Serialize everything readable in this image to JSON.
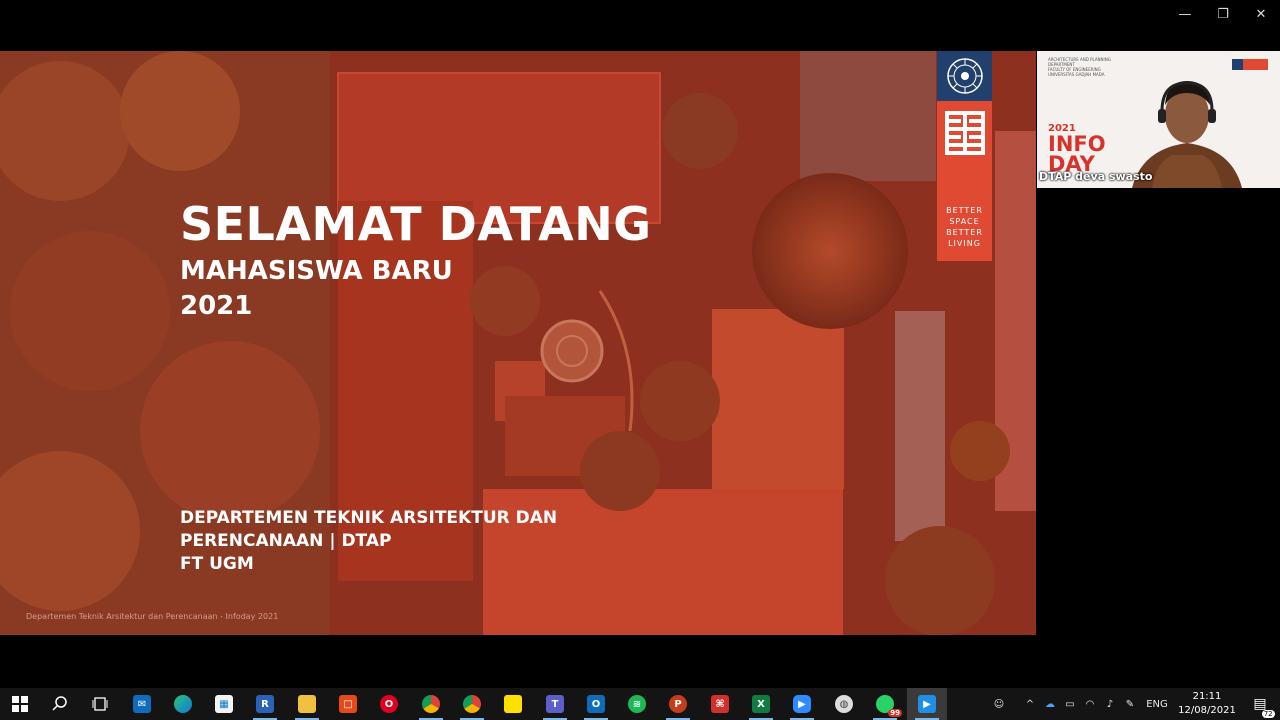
{
  "window": {
    "minimize_glyph": "—",
    "restore_glyph": "❐",
    "close_glyph": "✕"
  },
  "slide": {
    "title": "SELAMAT DATANG",
    "subtitle_line1": "MAHASISWA BARU",
    "subtitle_line2": "2021",
    "department_line1": "DEPARTEMEN TEKNIK ARSITEKTUR DAN",
    "department_line2": "PERENCANAAN | DTAP",
    "department_line3": "FT UGM",
    "footer": "Departemen Teknik Arsitektur dan Perencanaan - Infoday 2021",
    "logo_tagline": [
      "BETTER",
      "SPACE",
      "BETTER",
      "LIVING"
    ]
  },
  "video": {
    "participant_name": "DTAP deva swasto",
    "header_lines": [
      "ARCHITECTURE AND PLANNING DEPARTMENT",
      "FACULTY OF ENGINEERING",
      "UNIVERSITAS GADJAH MADA"
    ],
    "event_year": "2021",
    "event_word1": "INFO",
    "event_word2": "DAY"
  },
  "taskbar": {
    "apps": [
      {
        "name": "start",
        "icon": "windows-logo-icon"
      },
      {
        "name": "search",
        "icon": "search-icon"
      },
      {
        "name": "task-view",
        "icon": "task-view-icon"
      },
      {
        "name": "mail",
        "icon": "mail-icon"
      },
      {
        "name": "edge",
        "icon": "edge-icon"
      },
      {
        "name": "store",
        "icon": "store-icon"
      },
      {
        "name": "revit",
        "icon": "revit-icon",
        "glyph": "R"
      },
      {
        "name": "file-explorer",
        "icon": "folder-icon"
      },
      {
        "name": "office",
        "icon": "office-icon"
      },
      {
        "name": "opera",
        "icon": "opera-icon",
        "glyph": "O"
      },
      {
        "name": "chrome",
        "icon": "chrome-icon"
      },
      {
        "name": "chrome-profile",
        "icon": "chrome-icon"
      },
      {
        "name": "sticky-notes",
        "icon": "sticky-notes-icon"
      },
      {
        "name": "teams",
        "icon": "teams-icon",
        "glyph": "T"
      },
      {
        "name": "outlook",
        "icon": "outlook-icon",
        "glyph": "O"
      },
      {
        "name": "spotify",
        "icon": "spotify-icon"
      },
      {
        "name": "powerpoint",
        "icon": "powerpoint-icon",
        "glyph": "P"
      },
      {
        "name": "acrobat",
        "icon": "pdf-icon"
      },
      {
        "name": "excel",
        "icon": "excel-icon",
        "glyph": "X"
      },
      {
        "name": "zoom",
        "icon": "zoom-icon"
      },
      {
        "name": "network-app",
        "icon": "network-globe-icon"
      },
      {
        "name": "whatsapp",
        "icon": "whatsapp-icon",
        "badge": "99"
      },
      {
        "name": "zoom-meeting",
        "icon": "zoom-meeting-icon"
      }
    ],
    "tray": {
      "language": "ENG",
      "time": "21:11",
      "date": "12/08/2021",
      "notifications": "72"
    }
  },
  "colors": {
    "slide_overlay": "#9b2e1e",
    "logo_blue": "#22406e",
    "logo_red": "#e04a32",
    "taskbar": "#141414"
  }
}
